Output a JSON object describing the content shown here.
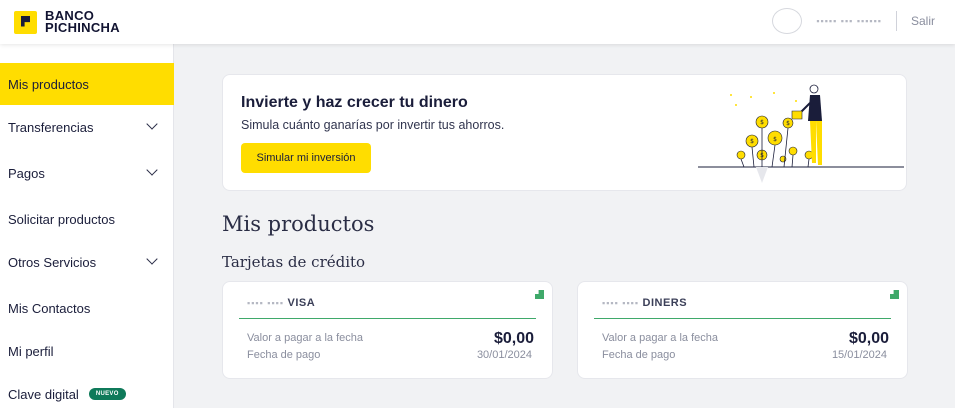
{
  "brand": {
    "line1": "BANCO",
    "line2": "PICHINCHA",
    "yellow": "#ffdd00",
    "navy": "#1a1d3a"
  },
  "header": {
    "logout_label": "Salir"
  },
  "sidebar": {
    "items": [
      {
        "label": "Mis productos",
        "active": true,
        "expandable": false
      },
      {
        "label": "Transferencias",
        "expandable": true
      },
      {
        "label": "Pagos",
        "expandable": true
      },
      {
        "label": "Solicitar productos",
        "expandable": false
      },
      {
        "label": "Otros Servicios",
        "expandable": true
      },
      {
        "label": "Mis Contactos",
        "expandable": false
      },
      {
        "label": "Mi perfil",
        "expandable": false
      },
      {
        "label": "Clave digital",
        "expandable": false,
        "badge": "NUEVO"
      }
    ]
  },
  "promo": {
    "title": "Invierte y haz crecer tu dinero",
    "subtitle": "Simula cuánto ganarías por invertir tus ahorros.",
    "button_label": "Simular mi inversión"
  },
  "main": {
    "title": "Mis productos",
    "subtitle": "Tarjetas de crédito"
  },
  "cards": [
    {
      "name": "VISA",
      "label_amount": "Valor a pagar a la fecha",
      "label_date": "Fecha de pago",
      "amount": "$0,00",
      "date": "30/01/2024"
    },
    {
      "name": "DINERS",
      "label_amount": "Valor a pagar a la fecha",
      "label_date": "Fecha de pago",
      "amount": "$0,00",
      "date": "15/01/2024"
    }
  ],
  "colors": {
    "accent_green": "#3fa96a",
    "badge_green": "#0f7a5a"
  }
}
